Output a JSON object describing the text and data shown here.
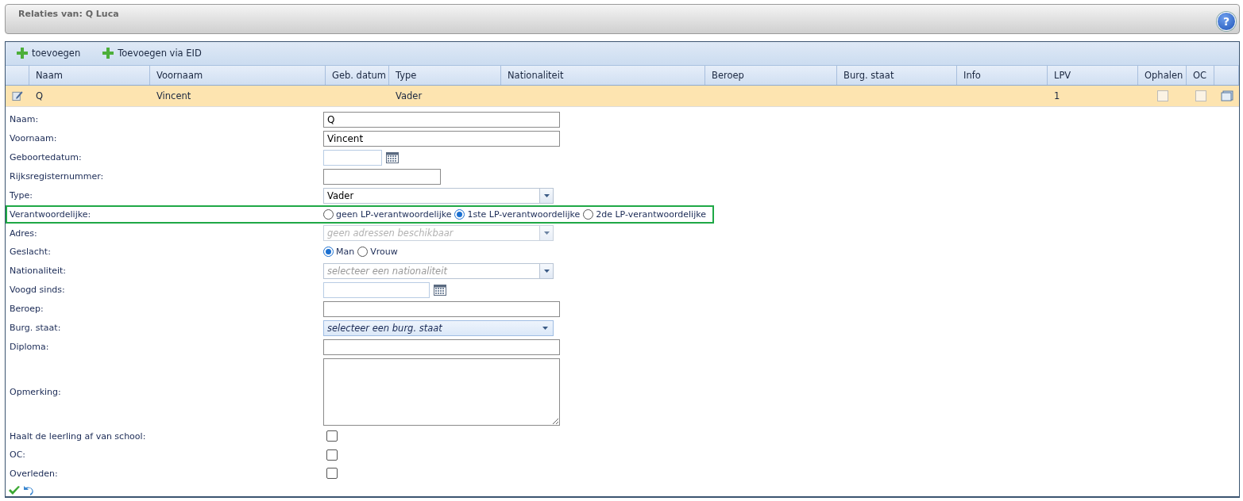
{
  "header": {
    "title": "Relaties van: Q Luca",
    "help": "?"
  },
  "toolbar": [
    {
      "label": "toevoegen"
    },
    {
      "label": "Toevoegen via EID"
    }
  ],
  "table": {
    "columns": [
      "Naam",
      "Voornaam",
      "Geb. datum",
      "Type",
      "Nationaliteit",
      "Beroep",
      "Burg. staat",
      "Info",
      "LPV",
      "Ophalen",
      "OC"
    ],
    "rows": [
      {
        "cells": [
          "Q",
          "Vincent",
          "",
          "Vader",
          "",
          "",
          "",
          "",
          "1"
        ],
        "ophalen": false,
        "oc": false,
        "selected": true
      }
    ]
  },
  "form": {
    "fields": [
      {
        "label": "Naam:",
        "kind": "text",
        "value": "Q"
      },
      {
        "label": "Voornaam:",
        "kind": "text",
        "value": "Vincent"
      },
      {
        "label": "Geboortedatum:",
        "kind": "date"
      },
      {
        "label": "Rijksregisternummer:",
        "kind": "text"
      },
      {
        "label": "Type:",
        "kind": "select",
        "value": "Vader"
      },
      {
        "label": "Verantwoordelijke:",
        "kind": "radio",
        "highlighted": true,
        "options": [
          {
            "label": "geen LP-verantwoordelijke",
            "selected": false
          },
          {
            "label": "1ste LP-verantwoordelijke",
            "selected": true
          },
          {
            "label": "2de LP-verantwoordelijke",
            "selected": false
          }
        ]
      },
      {
        "label": "Adres:",
        "kind": "select",
        "placeholder": "geen adressen beschikbaar",
        "disabled": true
      },
      {
        "label": "Geslacht:",
        "kind": "radio",
        "options": [
          {
            "label": "Man",
            "selected": true
          },
          {
            "label": "Vrouw",
            "selected": false
          }
        ]
      },
      {
        "label": "Nationaliteit:",
        "kind": "select",
        "placeholder": "selecteer een nationaliteit"
      },
      {
        "label": "Voogd sinds:",
        "kind": "date"
      },
      {
        "label": "Beroep:",
        "kind": "text"
      },
      {
        "label": "Burg. staat:",
        "kind": "select",
        "placeholder": "selecteer een burg. staat",
        "hovered": true
      },
      {
        "label": "Diploma:",
        "kind": "text"
      },
      {
        "label": "Opmerking:",
        "kind": "textarea"
      },
      {
        "label": "Haalt de leerling af van school:",
        "kind": "checkbox",
        "checked": false
      },
      {
        "label": "OC:",
        "kind": "checkbox",
        "checked": false
      },
      {
        "label": "Overleden:",
        "kind": "checkbox",
        "checked": false
      }
    ]
  }
}
